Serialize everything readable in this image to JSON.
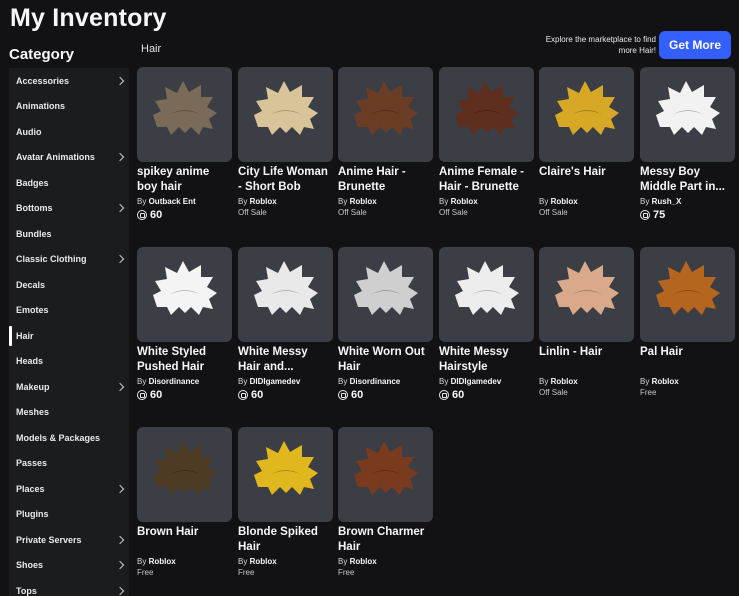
{
  "page": {
    "title": "My Inventory"
  },
  "sidebar": {
    "heading": "Category",
    "items": [
      {
        "label": "Accessories",
        "chevron": true,
        "active": false
      },
      {
        "label": "Animations",
        "chevron": false,
        "active": false
      },
      {
        "label": "Audio",
        "chevron": false,
        "active": false
      },
      {
        "label": "Avatar Animations",
        "chevron": true,
        "active": false
      },
      {
        "label": "Badges",
        "chevron": false,
        "active": false
      },
      {
        "label": "Bottoms",
        "chevron": true,
        "active": false
      },
      {
        "label": "Bundles",
        "chevron": false,
        "active": false
      },
      {
        "label": "Classic Clothing",
        "chevron": true,
        "active": false
      },
      {
        "label": "Decals",
        "chevron": false,
        "active": false
      },
      {
        "label": "Emotes",
        "chevron": false,
        "active": false
      },
      {
        "label": "Hair",
        "chevron": false,
        "active": true
      },
      {
        "label": "Heads",
        "chevron": false,
        "active": false
      },
      {
        "label": "Makeup",
        "chevron": true,
        "active": false
      },
      {
        "label": "Meshes",
        "chevron": false,
        "active": false
      },
      {
        "label": "Models & Packages",
        "chevron": false,
        "active": false
      },
      {
        "label": "Passes",
        "chevron": false,
        "active": false
      },
      {
        "label": "Places",
        "chevron": true,
        "active": false
      },
      {
        "label": "Plugins",
        "chevron": false,
        "active": false
      },
      {
        "label": "Private Servers",
        "chevron": true,
        "active": false
      },
      {
        "label": "Shoes",
        "chevron": true,
        "active": false
      },
      {
        "label": "Tops",
        "chevron": true,
        "active": false
      }
    ]
  },
  "main": {
    "section_label": "Hair",
    "explore_text": "Explore the marketplace to find more Hair!",
    "get_more_label": "Get More"
  },
  "items": [
    {
      "name": "spikey anime boy hair",
      "by": "By",
      "creator": "Outback Ent",
      "price": "60",
      "status": "",
      "color": "#7a6a58"
    },
    {
      "name": "City Life Woman - Short Bob",
      "by": "By",
      "creator": "Roblox",
      "price": "",
      "status": "Off Sale",
      "color": "#d9c49a"
    },
    {
      "name": "Anime Hair - Brunette",
      "by": "By",
      "creator": "Roblox",
      "price": "",
      "status": "Off Sale",
      "color": "#6b3d25"
    },
    {
      "name": "Anime Female - Hair - Brunette",
      "by": "By",
      "creator": "Roblox",
      "price": "",
      "status": "Off Sale",
      "color": "#5e2f1e"
    },
    {
      "name": "Claire's Hair",
      "by": "By",
      "creator": "Roblox",
      "price": "",
      "status": "Off Sale",
      "color": "#d6a826"
    },
    {
      "name": "Messy Boy Middle Part in...",
      "by": "By",
      "creator": "Rush_X",
      "price": "75",
      "status": "",
      "color": "#f2f2f2"
    },
    {
      "name": "White Styled Pushed Hair",
      "by": "By",
      "creator": "Disordinance",
      "price": "60",
      "status": "",
      "color": "#f4f4f4"
    },
    {
      "name": "White Messy Hair and...",
      "by": "By",
      "creator": "DIDIgamedev",
      "price": "60",
      "status": "",
      "color": "#e9e9e9"
    },
    {
      "name": "White Worn Out Hair",
      "by": "By",
      "creator": "Disordinance",
      "price": "60",
      "status": "",
      "color": "#cfcfcf"
    },
    {
      "name": "White Messy Hairstyle",
      "by": "By",
      "creator": "DIDIgamedev",
      "price": "60",
      "status": "",
      "color": "#ededed"
    },
    {
      "name": "Linlin - Hair",
      "by": "By",
      "creator": "Roblox",
      "price": "",
      "status": "Off Sale",
      "color": "#d9a98a"
    },
    {
      "name": "Pal Hair",
      "by": "By",
      "creator": "Roblox",
      "price": "",
      "status": "Free",
      "color": "#b5651d"
    },
    {
      "name": "Brown Hair",
      "by": "By",
      "creator": "Roblox",
      "price": "",
      "status": "Free",
      "color": "#4e3b24"
    },
    {
      "name": "Blonde Spiked Hair",
      "by": "By",
      "creator": "Roblox",
      "price": "",
      "status": "Free",
      "color": "#e0b81e"
    },
    {
      "name": "Brown Charmer Hair",
      "by": "By",
      "creator": "Roblox",
      "price": "",
      "status": "Free",
      "color": "#7a3a1e"
    }
  ]
}
